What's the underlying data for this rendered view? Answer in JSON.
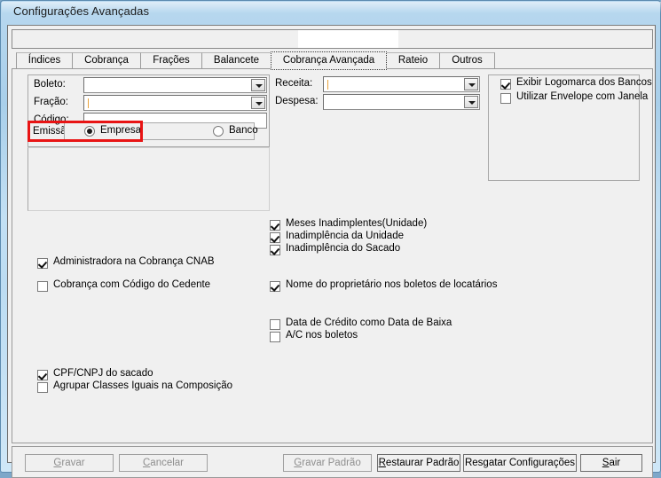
{
  "window": {
    "title": "Configurações Avançadas"
  },
  "tabs": [
    {
      "label": "Índices",
      "selected": false
    },
    {
      "label": "Cobrança",
      "selected": false
    },
    {
      "label": "Frações",
      "selected": false
    },
    {
      "label": "Balancete",
      "selected": false
    },
    {
      "label": "Cobrança Avançada",
      "selected": true
    },
    {
      "label": "Rateio",
      "selected": false
    },
    {
      "label": "Outros",
      "selected": false
    }
  ],
  "fields": {
    "boleto": {
      "label": "Boleto:",
      "value": "",
      "type": "combobox"
    },
    "fracao": {
      "label": "Fração:",
      "value": "",
      "type": "combobox"
    },
    "codigo": {
      "label": "Código:",
      "value": "",
      "type": "textbox"
    },
    "receita": {
      "label": "Receita:",
      "value": "",
      "type": "combobox"
    },
    "despesa": {
      "label": "Despesa:",
      "value": "",
      "type": "combobox"
    }
  },
  "emissao": {
    "label": "Emissão:",
    "options": [
      {
        "label": "Empresa",
        "checked": true
      },
      {
        "label": "Banco",
        "checked": false
      }
    ]
  },
  "right_group": {
    "items": [
      {
        "label": "Exibir Logomarca dos Bancos",
        "checked": true
      },
      {
        "label": "Utilizar Envelope com Janela",
        "checked": false
      }
    ]
  },
  "left_checkboxes": [
    {
      "label": "Administradora na Cobrança CNAB",
      "checked": true
    },
    {
      "label": "Cobrança com Código do Cedente",
      "checked": false
    },
    {
      "label": "CPF/CNPJ do sacado",
      "checked": true
    },
    {
      "label": "Agrupar Classes Iguais na Composição",
      "checked": false
    }
  ],
  "middle_checkboxes": [
    {
      "label": "Meses Inadimplentes(Unidade)",
      "checked": true
    },
    {
      "label": "Inadimplência da Unidade",
      "checked": true
    },
    {
      "label": "Inadimplência do Sacado",
      "checked": true
    },
    {
      "label": "Nome do proprietário nos boletos de locatários",
      "checked": true
    },
    {
      "label": "Data de Crédito como Data de Baixa",
      "checked": false
    },
    {
      "label": "A/C nos boletos",
      "checked": false
    }
  ],
  "buttons": [
    {
      "label": "Gravar",
      "mnemonic": "G",
      "enabled": false
    },
    {
      "label": "Cancelar",
      "mnemonic": "C",
      "enabled": false
    },
    {
      "label": "Gravar Padrão",
      "mnemonic": "G",
      "enabled": false
    },
    {
      "label": "Restaurar Padrão",
      "mnemonic": "R",
      "enabled": true
    },
    {
      "label": "Resgatar Configurações",
      "mnemonic": "",
      "enabled": true
    },
    {
      "label": "Sair",
      "mnemonic": "S",
      "enabled": true
    }
  ],
  "colors": {
    "highlight": "#e81414",
    "titlebar": "#b8d8ef",
    "face": "#f0f0f0"
  }
}
